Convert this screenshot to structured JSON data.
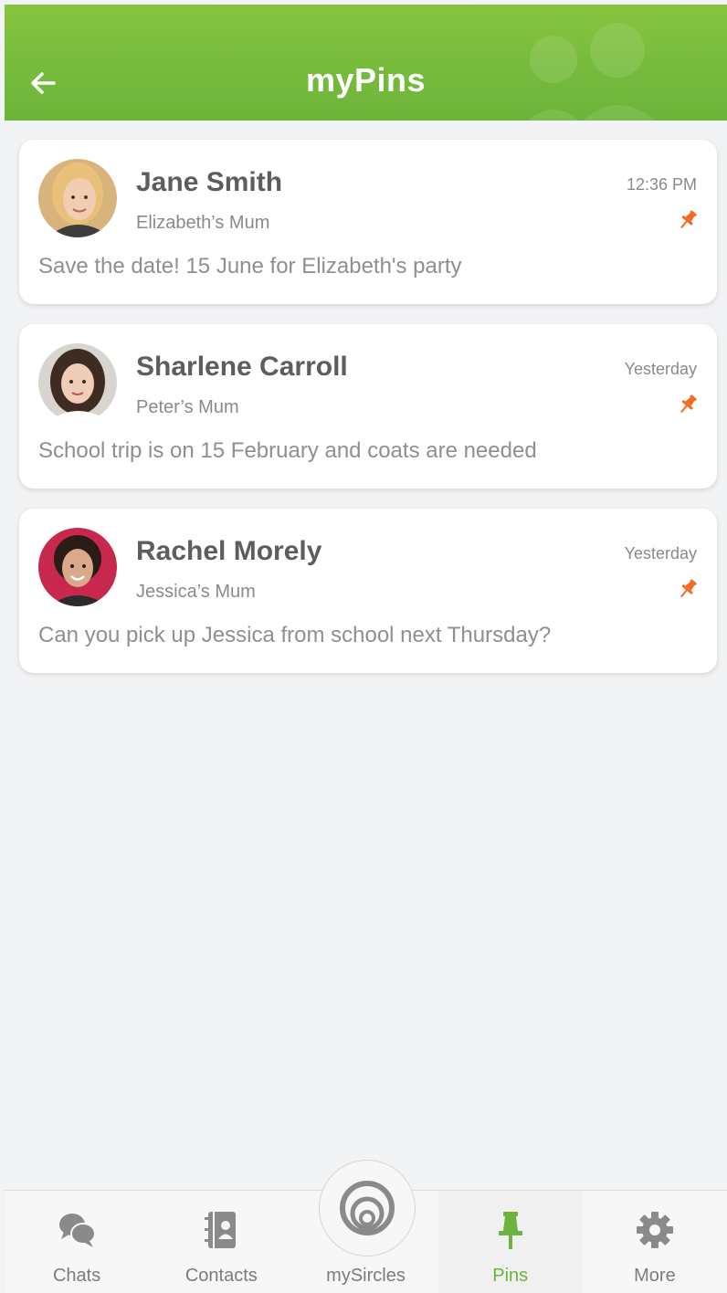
{
  "header": {
    "title": "myPins",
    "color": "#6bb43a"
  },
  "pins": [
    {
      "name": "Jane Smith",
      "relation": "Elizabeth’s Mum",
      "time": "12:36 PM",
      "message": "Save the date! 15 June for Elizabeth's party",
      "avatar_tone": "#e8b46a"
    },
    {
      "name": "Sharlene Carroll",
      "relation": "Peter’s Mum",
      "time": "Yesterday",
      "message": "School trip is on 15 February and coats are needed",
      "avatar_tone": "#4a3528"
    },
    {
      "name": "Rachel Morely",
      "relation": "Jessica’s Mum",
      "time": "Yesterday",
      "message": "Can you pick up Jessica from school next Thursday?",
      "avatar_tone": "#c8284e"
    }
  ],
  "tabs": {
    "chats": "Chats",
    "contacts": "Contacts",
    "mysircles": "mySircles",
    "pins": "Pins",
    "more": "More"
  },
  "colors": {
    "accent": "#6cb33f",
    "pin": "#f26a21",
    "icon_grey": "#8a8a8a"
  }
}
